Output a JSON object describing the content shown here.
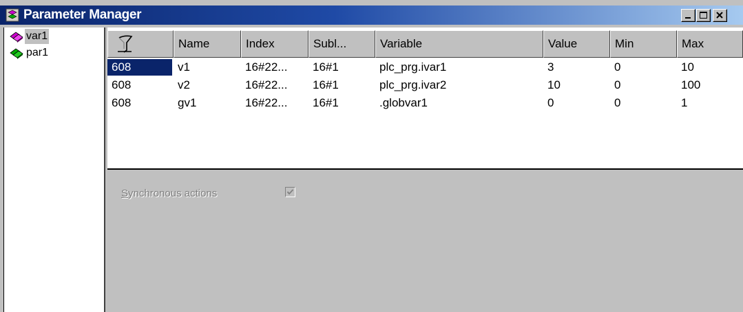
{
  "window": {
    "title": "Parameter Manager",
    "minimize_icon": "minimize-icon",
    "maximize_icon": "maximize-icon",
    "close_icon": "close-icon"
  },
  "tree": {
    "items": [
      {
        "label": "var1",
        "icon": "variable-list-icon",
        "color": "#cc00cc",
        "selected": true
      },
      {
        "label": "par1",
        "icon": "parameter-list-icon",
        "color": "#00aa00",
        "selected": false
      }
    ]
  },
  "table": {
    "columns": [
      "",
      "Name",
      "Index",
      "Subl...",
      "Variable",
      "Value",
      "Min",
      "Max"
    ],
    "filter_icon": "filter-icon",
    "rows": [
      [
        "608",
        "v1",
        "16#22...",
        "16#1",
        "plc_prg.ivar1",
        "3",
        "0",
        "10"
      ],
      [
        "608",
        "v2",
        "16#22...",
        "16#1",
        "plc_prg.ivar2",
        "10",
        "0",
        "100"
      ],
      [
        "608",
        "gv1",
        "16#22...",
        "16#1",
        ".globvar1",
        "0",
        "0",
        "1"
      ]
    ]
  },
  "options": {
    "sync_label": "Synchronous actions",
    "sync_label_underline": "S",
    "sync_label_rest": "ynchronous actions",
    "sync_checked": true
  }
}
